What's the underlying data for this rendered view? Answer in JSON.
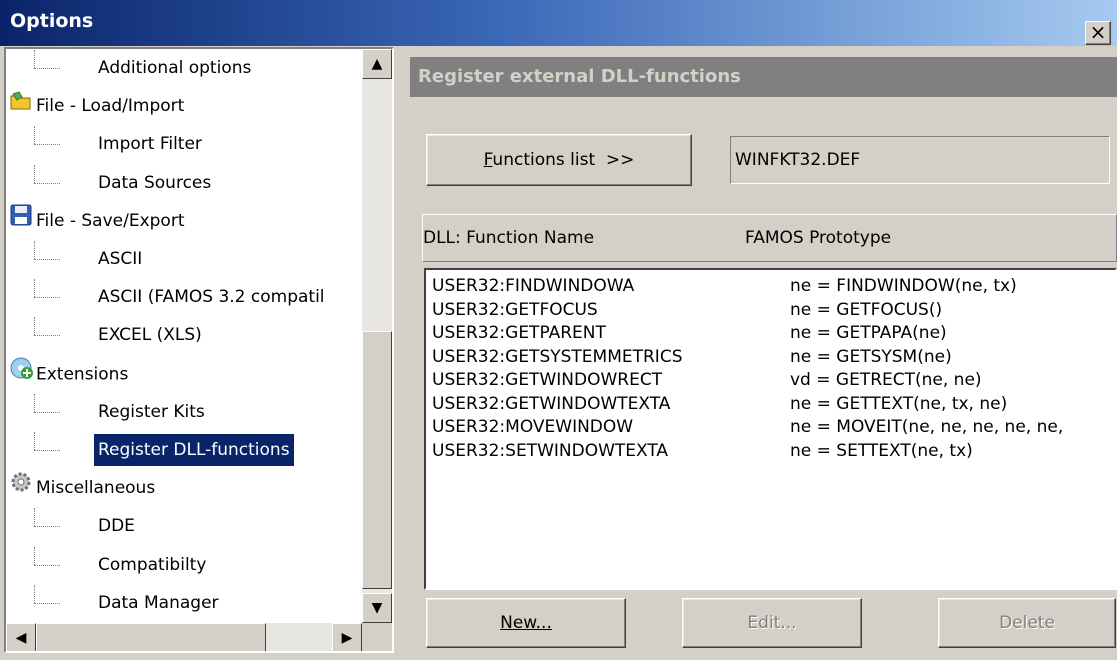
{
  "window": {
    "title": "Options",
    "close_label": "×"
  },
  "tree": {
    "items": [
      {
        "label": "Additional options",
        "level": 1,
        "icon": "none"
      },
      {
        "label": "File - Load/Import",
        "level": 0,
        "icon": "folder-icon"
      },
      {
        "label": "Import Filter",
        "level": 1,
        "icon": "none"
      },
      {
        "label": "Data Sources",
        "level": 1,
        "icon": "none"
      },
      {
        "label": "File - Save/Export",
        "level": 0,
        "icon": "floppy-icon"
      },
      {
        "label": "ASCII",
        "level": 1,
        "icon": "none"
      },
      {
        "label": "ASCII (FAMOS 3.2 compatil",
        "level": 1,
        "icon": "none"
      },
      {
        "label": "EXCEL (XLS)",
        "level": 1,
        "icon": "none"
      },
      {
        "label": "Extensions",
        "level": 0,
        "icon": "extensions-icon"
      },
      {
        "label": "Register Kits",
        "level": 1,
        "icon": "none"
      },
      {
        "label": "Register DLL-functions",
        "level": 1,
        "icon": "none",
        "selected": true
      },
      {
        "label": "Miscellaneous",
        "level": 0,
        "icon": "gear-icon"
      },
      {
        "label": "DDE",
        "level": 1,
        "icon": "none"
      },
      {
        "label": "Compatibilty",
        "level": 1,
        "icon": "none"
      },
      {
        "label": "Data Manager",
        "level": 1,
        "icon": "none"
      }
    ],
    "scroll_up": "▲",
    "scroll_down": "▼",
    "scroll_left": "◀",
    "scroll_right": "▶"
  },
  "panel": {
    "header": "Register external DLL-functions",
    "functions_button_label": "Functions list  >>",
    "functions_button_accel": "F",
    "def_file": "WINFKT32.DEF",
    "columns": [
      "DLL: Function Name",
      "FAMOS Prototype"
    ],
    "rows": [
      {
        "name": "USER32:FINDWINDOWA",
        "proto": "ne = FINDWINDOW(ne, tx)"
      },
      {
        "name": "USER32:GETFOCUS",
        "proto": "ne = GETFOCUS()"
      },
      {
        "name": "USER32:GETPARENT",
        "proto": "ne = GETPAPA(ne)"
      },
      {
        "name": "USER32:GETSYSTEMMETRICS",
        "proto": "ne = GETSYSM(ne)"
      },
      {
        "name": "USER32:GETWINDOWRECT",
        "proto": "vd = GETRECT(ne, ne)"
      },
      {
        "name": "USER32:GETWINDOWTEXTA",
        "proto": "ne = GETTEXT(ne, tx, ne)"
      },
      {
        "name": "USER32:MOVEWINDOW",
        "proto": "ne = MOVEIT(ne, ne, ne, ne, ne,"
      },
      {
        "name": "USER32:SETWINDOWTEXTA",
        "proto": "ne = SETTEXT(ne, tx)"
      }
    ],
    "buttons": {
      "new": "New...",
      "edit": "Edit...",
      "delete": "Delete"
    }
  }
}
